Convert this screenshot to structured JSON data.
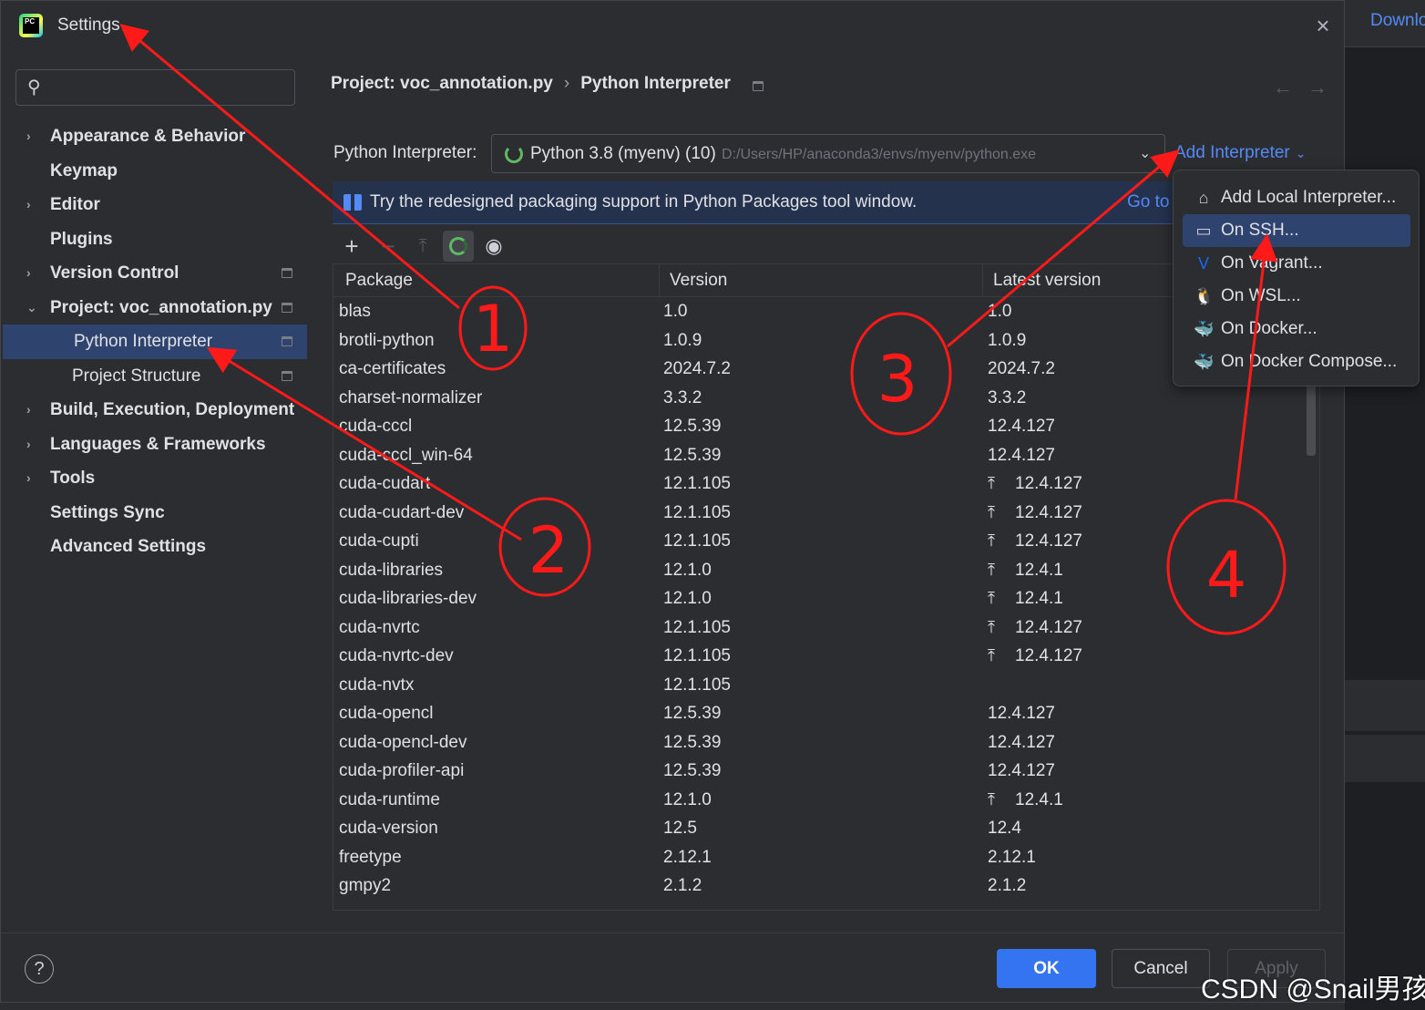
{
  "backdrop": {
    "top_link": "Downlo"
  },
  "window": {
    "title": "Settings"
  },
  "sidebar": {
    "search_placeholder": "",
    "items": [
      {
        "label": "Appearance & Behavior",
        "chevron": "›"
      },
      {
        "label": "Keymap",
        "chevron": ""
      },
      {
        "label": "Editor",
        "chevron": "›"
      },
      {
        "label": "Plugins",
        "chevron": ""
      },
      {
        "label": "Version Control",
        "chevron": "›"
      },
      {
        "label": "Project: voc_annotation.py",
        "chevron": "⌄"
      },
      {
        "label": "Python Interpreter",
        "chevron": ""
      },
      {
        "label": "Project Structure",
        "chevron": ""
      },
      {
        "label": "Build, Execution, Deployment",
        "chevron": "›"
      },
      {
        "label": "Languages & Frameworks",
        "chevron": "›"
      },
      {
        "label": "Tools",
        "chevron": "›"
      },
      {
        "label": "Settings Sync",
        "chevron": ""
      },
      {
        "label": "Advanced Settings",
        "chevron": ""
      }
    ]
  },
  "breadcrumb": {
    "project": "Project: voc_annotation.py",
    "separator": "›",
    "page": "Python Interpreter"
  },
  "interpreter": {
    "label": "Python Interpreter:",
    "name": "Python 3.8 (myenv) (10)",
    "path": "D:/Users/HP/anaconda3/envs/myenv/python.exe",
    "add_label": "Add Interpreter"
  },
  "banner": {
    "text": "Try the redesigned packaging support in Python Packages tool window.",
    "link": "Go to"
  },
  "table": {
    "headers": [
      "Package",
      "Version",
      "Latest version"
    ],
    "rows": [
      {
        "package": "blas",
        "version": "1.0",
        "latest": "1.0",
        "upgrade": false
      },
      {
        "package": "brotli-python",
        "version": "1.0.9",
        "latest": "1.0.9",
        "upgrade": false
      },
      {
        "package": "ca-certificates",
        "version": "2024.7.2",
        "latest": "2024.7.2",
        "upgrade": false
      },
      {
        "package": "charset-normalizer",
        "version": "3.3.2",
        "latest": "3.3.2",
        "upgrade": false
      },
      {
        "package": "cuda-cccl",
        "version": "12.5.39",
        "latest": "12.4.127",
        "upgrade": false
      },
      {
        "package": "cuda-cccl_win-64",
        "version": "12.5.39",
        "latest": "12.4.127",
        "upgrade": false
      },
      {
        "package": "cuda-cudart",
        "version": "12.1.105",
        "latest": "12.4.127",
        "upgrade": true
      },
      {
        "package": "cuda-cudart-dev",
        "version": "12.1.105",
        "latest": "12.4.127",
        "upgrade": true
      },
      {
        "package": "cuda-cupti",
        "version": "12.1.105",
        "latest": "12.4.127",
        "upgrade": true
      },
      {
        "package": "cuda-libraries",
        "version": "12.1.0",
        "latest": "12.4.1",
        "upgrade": true
      },
      {
        "package": "cuda-libraries-dev",
        "version": "12.1.0",
        "latest": "12.4.1",
        "upgrade": true
      },
      {
        "package": "cuda-nvrtc",
        "version": "12.1.105",
        "latest": "12.4.127",
        "upgrade": true
      },
      {
        "package": "cuda-nvrtc-dev",
        "version": "12.1.105",
        "latest": "12.4.127",
        "upgrade": true
      },
      {
        "package": "cuda-nvtx",
        "version": "12.1.105",
        "latest": "",
        "upgrade": false
      },
      {
        "package": "cuda-opencl",
        "version": "12.5.39",
        "latest": "12.4.127",
        "upgrade": false
      },
      {
        "package": "cuda-opencl-dev",
        "version": "12.5.39",
        "latest": "12.4.127",
        "upgrade": false
      },
      {
        "package": "cuda-profiler-api",
        "version": "12.5.39",
        "latest": "12.4.127",
        "upgrade": false
      },
      {
        "package": "cuda-runtime",
        "version": "12.1.0",
        "latest": "12.4.1",
        "upgrade": true
      },
      {
        "package": "cuda-version",
        "version": "12.5",
        "latest": "12.4",
        "upgrade": false
      },
      {
        "package": "freetype",
        "version": "2.12.1",
        "latest": "2.12.1",
        "upgrade": false
      },
      {
        "package": "gmpy2",
        "version": "2.1.2",
        "latest": "2.1.2",
        "upgrade": false
      }
    ]
  },
  "add_menu": {
    "items": [
      {
        "label": "Add Local Interpreter...",
        "icon": "home-icon",
        "glyph": "⌂",
        "color": "#ced0d6"
      },
      {
        "label": "On SSH...",
        "icon": "terminal-icon",
        "glyph": "▭",
        "color": "#ced0d6"
      },
      {
        "label": "On Vagrant...",
        "icon": "vagrant-icon",
        "glyph": "V",
        "color": "#1868f2"
      },
      {
        "label": "On WSL...",
        "icon": "linux-penguin-icon",
        "glyph": "🐧",
        "color": "#f0c33c"
      },
      {
        "label": "On Docker...",
        "icon": "docker-icon",
        "glyph": "🐳",
        "color": "#548af7"
      },
      {
        "label": "On Docker Compose...",
        "icon": "docker-compose-icon",
        "glyph": "🐳",
        "color": "#548af7"
      }
    ],
    "selected": "On SSH..."
  },
  "footer": {
    "help": "?",
    "ok": "OK",
    "cancel": "Cancel",
    "apply": "Apply"
  },
  "watermark": "CSDN @Snail男孩",
  "annotations": {
    "circle_numbers": [
      "1",
      "2",
      "3",
      "4"
    ],
    "color": "#ff1a1a"
  }
}
